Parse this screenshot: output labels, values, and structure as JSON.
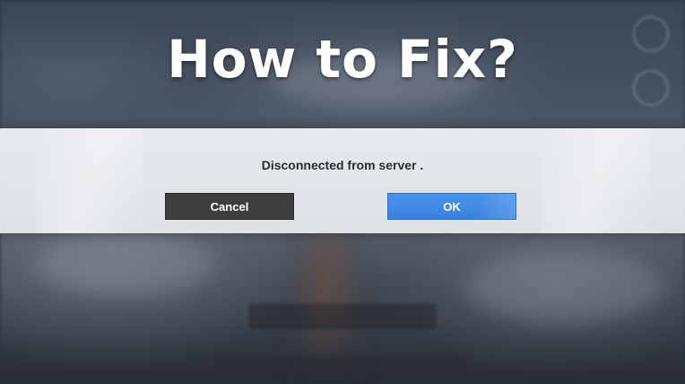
{
  "overlay": {
    "headline": "How to Fix?"
  },
  "dialog": {
    "message": "Disconnected from server .",
    "cancel_label": "Cancel",
    "ok_label": "OK"
  },
  "colors": {
    "ok_button": "#3a82dd",
    "cancel_button": "#3e3e3e",
    "dialog_bg": "#eceef1"
  }
}
